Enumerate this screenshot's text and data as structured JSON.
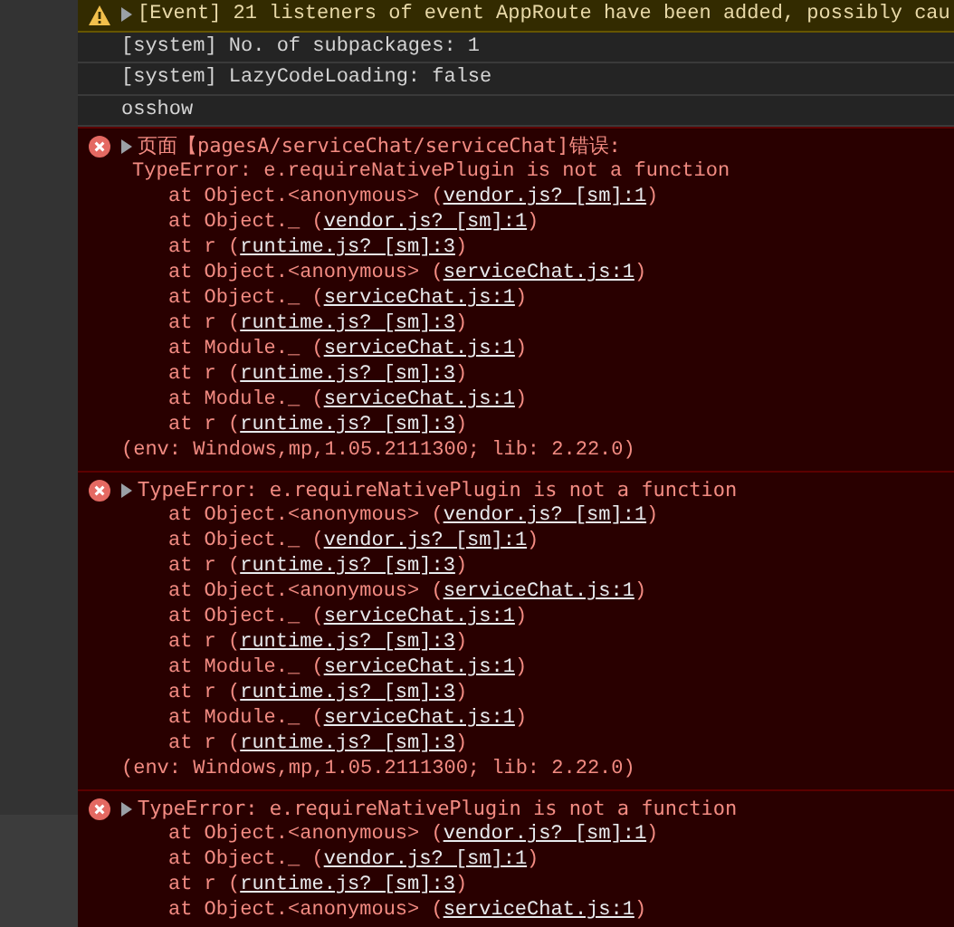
{
  "messages": [
    {
      "kind": "warning",
      "text": "[Event] 21 listeners of event AppRoute have been added, possibly cau"
    },
    {
      "kind": "log",
      "text": "[system] No. of subpackages: 1"
    },
    {
      "kind": "log",
      "text": "[system] LazyCodeLoading: false"
    },
    {
      "kind": "log",
      "text": "osshow"
    },
    {
      "kind": "error",
      "text": "页面【pagesA/serviceChat/serviceChat]错误:",
      "detail": "TypeError: e.requireNativePlugin is not a function",
      "frames": [
        {
          "before": "at Object.<anonymous> (",
          "link": "vendor.js? [sm]:1",
          "after": ")"
        },
        {
          "before": "at Object._ (",
          "link": "vendor.js? [sm]:1",
          "after": ")"
        },
        {
          "before": "at r (",
          "link": "runtime.js? [sm]:3",
          "after": ")"
        },
        {
          "before": "at Object.<anonymous> (",
          "link": "serviceChat.js:1",
          "after": ")"
        },
        {
          "before": "at Object._ (",
          "link": "serviceChat.js:1",
          "after": ")"
        },
        {
          "before": "at r (",
          "link": "runtime.js? [sm]:3",
          "after": ")"
        },
        {
          "before": "at Module._ (",
          "link": "serviceChat.js:1",
          "after": ")"
        },
        {
          "before": "at r (",
          "link": "runtime.js? [sm]:3",
          "after": ")"
        },
        {
          "before": "at Module._ (",
          "link": "serviceChat.js:1",
          "after": ")"
        },
        {
          "before": "at r (",
          "link": "runtime.js? [sm]:3",
          "after": ")"
        }
      ],
      "env": "(env: Windows,mp,1.05.2111300; lib: 2.22.0)"
    },
    {
      "kind": "error",
      "text": "TypeError: e.requireNativePlugin is not a function",
      "frames": [
        {
          "before": "at Object.<anonymous> (",
          "link": "vendor.js? [sm]:1",
          "after": ")"
        },
        {
          "before": "at Object._ (",
          "link": "vendor.js? [sm]:1",
          "after": ")"
        },
        {
          "before": "at r (",
          "link": "runtime.js? [sm]:3",
          "after": ")"
        },
        {
          "before": "at Object.<anonymous> (",
          "link": "serviceChat.js:1",
          "after": ")"
        },
        {
          "before": "at Object._ (",
          "link": "serviceChat.js:1",
          "after": ")"
        },
        {
          "before": "at r (",
          "link": "runtime.js? [sm]:3",
          "after": ")"
        },
        {
          "before": "at Module._ (",
          "link": "serviceChat.js:1",
          "after": ")"
        },
        {
          "before": "at r (",
          "link": "runtime.js? [sm]:3",
          "after": ")"
        },
        {
          "before": "at Module._ (",
          "link": "serviceChat.js:1",
          "after": ")"
        },
        {
          "before": "at r (",
          "link": "runtime.js? [sm]:3",
          "after": ")"
        }
      ],
      "env": "(env: Windows,mp,1.05.2111300; lib: 2.22.0)"
    },
    {
      "kind": "error",
      "text": "TypeError: e.requireNativePlugin is not a function",
      "frames": [
        {
          "before": "at Object.<anonymous> (",
          "link": "vendor.js? [sm]:1",
          "after": ")"
        },
        {
          "before": "at Object._ (",
          "link": "vendor.js? [sm]:1",
          "after": ")"
        },
        {
          "before": "at r (",
          "link": "runtime.js? [sm]:3",
          "after": ")"
        },
        {
          "before": "at Object.<anonymous> (",
          "link": "serviceChat.js:1",
          "after": ")"
        }
      ]
    }
  ]
}
